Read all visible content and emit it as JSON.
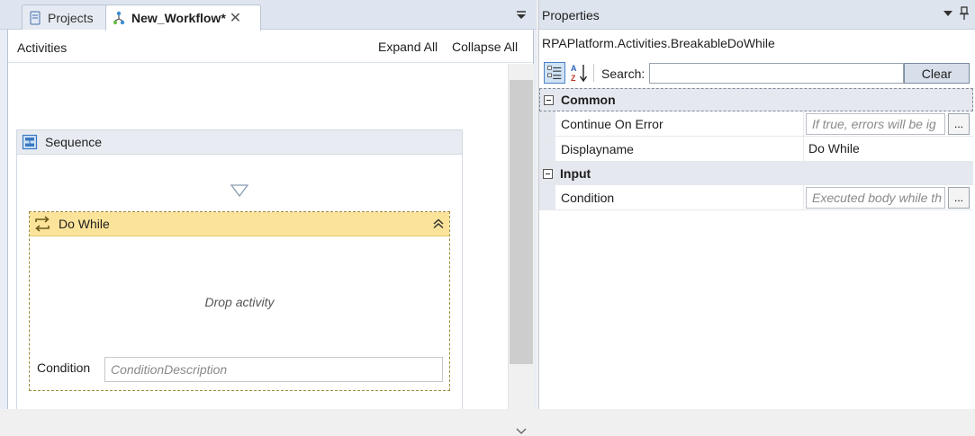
{
  "tabs": [
    {
      "label": "Projects",
      "icon": "document-icon",
      "active": false
    },
    {
      "label": "New_Workflow*",
      "icon": "workflow-icon",
      "active": true,
      "close": "✕"
    }
  ],
  "designer": {
    "header_title": "Activities",
    "expand_all": "Expand All",
    "collapse_all": "Collapse All",
    "sequence": {
      "title": "Sequence"
    },
    "do_while": {
      "title": "Do While",
      "drop_text": "Drop activity",
      "condition_label": "Condition",
      "condition_placeholder": "ConditionDescription"
    }
  },
  "properties": {
    "title": "Properties",
    "type_name": "RPAPlatform.Activities.BreakableDoWhile",
    "search_label": "Search:",
    "search_value": "",
    "clear_label": "Clear",
    "categories": [
      {
        "name": "Common",
        "props": [
          {
            "name": "Continue On Error",
            "placeholder": "If true, errors will be ig",
            "kind": "input",
            "ellipsis": "..."
          },
          {
            "name": "Displayname",
            "value": "Do While",
            "kind": "text"
          }
        ]
      },
      {
        "name": "Input",
        "props": [
          {
            "name": "Condition",
            "placeholder": "Executed body while th",
            "kind": "input",
            "ellipsis": "..."
          }
        ]
      }
    ]
  },
  "colors": {
    "do_while_header": "#fbe49a",
    "accent_blue": "#4a82c3"
  }
}
